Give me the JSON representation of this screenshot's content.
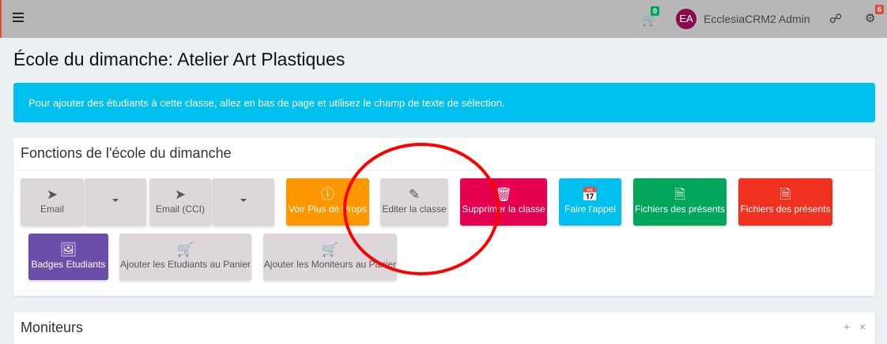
{
  "topbar": {
    "cart_count": "0",
    "avatar_initials": "EA",
    "user_name": "EcclesiaCRM2 Admin",
    "notif_count": "6",
    "colors": {
      "cart_badge": "#00a65a",
      "notif_badge": "#dd4b39"
    }
  },
  "page_title": "École du dimanche: Atelier Art Plastiques",
  "alert": "Pour ajouter des étudiants à cette classe, allez en bas de page et utilisez le champ de texte de sélection.",
  "functions_box": {
    "title": "Fonctions de l'école du dimanche",
    "buttons": [
      {
        "label": "Email",
        "icon": "paper-plane-outline-icon"
      },
      {
        "label": "Email (CCI)",
        "icon": "paper-plane-icon"
      },
      {
        "label": "Voir Plus de Props",
        "icon": "info-circle-icon",
        "color": "#ff9800"
      },
      {
        "label": "Editer la classe",
        "icon": "pencil-icon"
      },
      {
        "label": "Supprimer la classe",
        "icon": "trash-icon",
        "color": "#e5004f"
      },
      {
        "label": "Faire l'appel",
        "icon": "calendar-check-icon",
        "color": "#00c0ef"
      },
      {
        "label": "Fichiers des présents",
        "icon": "file-excel-icon",
        "color": "#00a65a"
      },
      {
        "label": "Fichiers des présents",
        "icon": "file-pdf-icon",
        "color": "#f0311f"
      },
      {
        "label": "Badges Etudiants",
        "icon": "file-image-icon",
        "color": "#6a4ea9"
      },
      {
        "label": "Ajouter les Etudiants au Panier",
        "icon": "cart-plus-icon"
      },
      {
        "label": "Ajouter les Moniteurs au Panier",
        "icon": "cart-plus-icon"
      }
    ]
  },
  "moniteurs_box": {
    "title": "Moniteurs",
    "expand": "+",
    "close": "×"
  }
}
